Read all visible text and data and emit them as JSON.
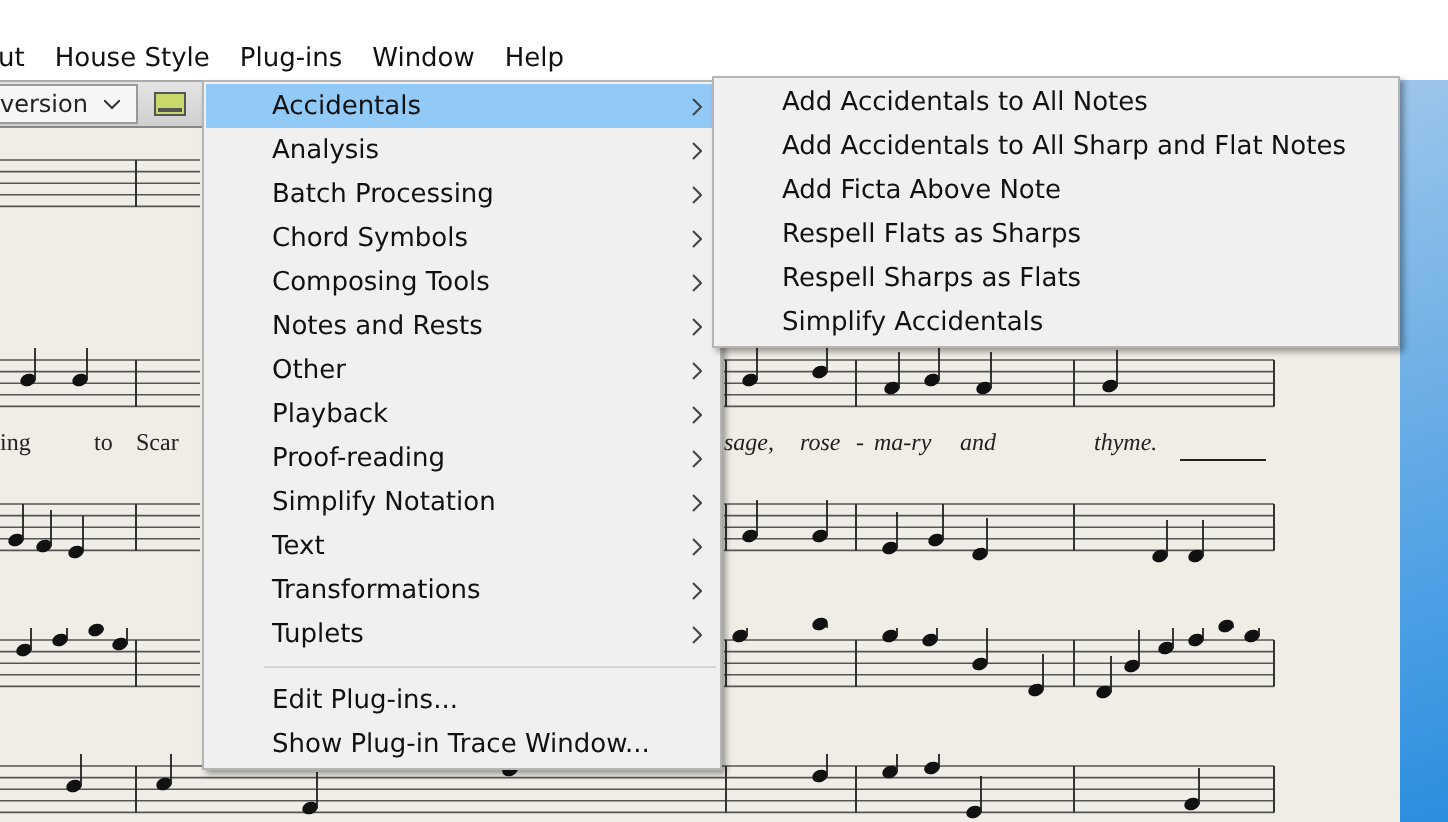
{
  "menubar": [
    {
      "label": "ut"
    },
    {
      "label": "House Style"
    },
    {
      "label": "Plug-ins"
    },
    {
      "label": "Window"
    },
    {
      "label": "Help"
    }
  ],
  "toolbar": {
    "dropdown_value": "version"
  },
  "plugins_menu": {
    "items": [
      {
        "label": "Accidentals",
        "kind": "submenu",
        "selected": true
      },
      {
        "label": "Analysis",
        "kind": "submenu",
        "selected": false
      },
      {
        "label": "Batch Processing",
        "kind": "submenu",
        "selected": false
      },
      {
        "label": "Chord Symbols",
        "kind": "submenu",
        "selected": false
      },
      {
        "label": "Composing Tools",
        "kind": "submenu",
        "selected": false
      },
      {
        "label": "Notes and Rests",
        "kind": "submenu",
        "selected": false
      },
      {
        "label": "Other",
        "kind": "submenu",
        "selected": false
      },
      {
        "label": "Playback",
        "kind": "submenu",
        "selected": false
      },
      {
        "label": "Proof-reading",
        "kind": "submenu",
        "selected": false
      },
      {
        "label": "Simplify Notation",
        "kind": "submenu",
        "selected": false
      },
      {
        "label": "Text",
        "kind": "submenu",
        "selected": false
      },
      {
        "label": "Transformations",
        "kind": "submenu",
        "selected": false
      },
      {
        "label": "Tuplets",
        "kind": "submenu",
        "selected": false
      },
      {
        "kind": "separator"
      },
      {
        "label": "Edit Plug-ins...",
        "kind": "command",
        "selected": false
      },
      {
        "label": "Show Plug-in Trace Window...",
        "kind": "command",
        "selected": false
      }
    ]
  },
  "accidentals_submenu": {
    "items": [
      {
        "label": "Add Accidentals to All Notes"
      },
      {
        "label": "Add Accidentals to All Sharp and Flat Notes"
      },
      {
        "label": "Add Ficta Above Note"
      },
      {
        "label": "Respell Flats as Sharps"
      },
      {
        "label": "Respell Sharps as Flats"
      },
      {
        "label": "Simplify Accidentals"
      }
    ]
  },
  "lyrics": [
    {
      "text": "ing",
      "kind": "upright"
    },
    {
      "text": "to",
      "kind": "upright"
    },
    {
      "text": "Scar",
      "kind": "upright"
    },
    {
      "text": "sage,",
      "kind": "italic"
    },
    {
      "text": "rose",
      "kind": "italic"
    },
    {
      "text": "-",
      "kind": "italic"
    },
    {
      "text": "ma-ry",
      "kind": "italic"
    },
    {
      "text": "and",
      "kind": "italic"
    },
    {
      "text": "thyme.",
      "kind": "italic"
    }
  ]
}
